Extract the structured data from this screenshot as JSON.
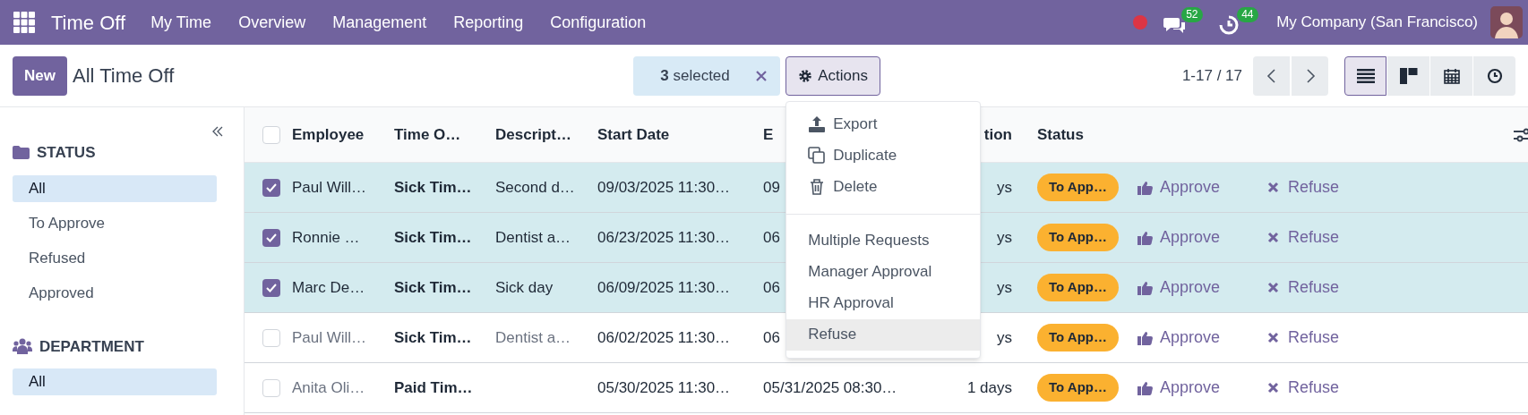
{
  "navbar": {
    "app_title": "Time Off",
    "menu": [
      "My Time",
      "Overview",
      "Management",
      "Reporting",
      "Configuration"
    ],
    "messages_count": "52",
    "activities_count": "44",
    "company": "My Company (San Francisco)"
  },
  "toolbar": {
    "new_button": "New",
    "breadcrumb": "All Time Off",
    "selection": "**3** selected",
    "actions_button": "Actions",
    "pager": "1-17 / 17",
    "views": [
      {
        "kind": "list",
        "selected": true
      },
      {
        "kind": "kanban",
        "selected": false
      },
      {
        "kind": "calendar",
        "selected": false
      },
      {
        "kind": "activity",
        "selected": false
      }
    ]
  },
  "actions_menu": [
    {
      "kind": "export",
      "label": "Export",
      "selected": false
    },
    {
      "kind": "duplicate",
      "label": "Duplicate",
      "selected": false
    },
    {
      "kind": "delete",
      "label": "Delete",
      "selected": false
    },
    {
      "kind": "plain",
      "label": "Multiple Requests",
      "selected": false
    },
    {
      "kind": "plain",
      "label": "Manager Approval",
      "selected": false
    },
    {
      "kind": "plain",
      "label": "HR Approval",
      "selected": false
    },
    {
      "kind": "plain",
      "label": "Refuse",
      "selected": true
    }
  ],
  "sidebar": {
    "sections": [
      {
        "kind": "folder",
        "title": "STATUS",
        "items": [
          {
            "label": "All",
            "selected": true
          },
          {
            "label": "To Approve",
            "selected": false
          },
          {
            "label": "Refused",
            "selected": false
          },
          {
            "label": "Approved",
            "selected": false
          }
        ]
      },
      {
        "kind": "users",
        "title": "DEPARTMENT",
        "items": [
          {
            "label": "All",
            "selected": true
          }
        ]
      }
    ]
  },
  "table": {
    "header_checked": false,
    "columns": [
      "Employee",
      "Time O…",
      "Descript…",
      "Start Date",
      "E",
      "tion",
      "Status"
    ],
    "rows": [
      {
        "selected": true,
        "employee": "Paul Will…",
        "time_off_type": "Sick Tim…",
        "description": "Second d…",
        "start_date": "09/03/2025 11:30…",
        "end_date": "09",
        "duration": "ys",
        "status": "To App…",
        "approve": "Approve",
        "refuse": "Refuse"
      },
      {
        "selected": true,
        "employee": "Ronnie …",
        "time_off_type": "Sick Tim…",
        "description": "Dentist a…",
        "start_date": "06/23/2025 11:30…",
        "end_date": "06",
        "duration": "ys",
        "status": "To App…",
        "approve": "Approve",
        "refuse": "Refuse"
      },
      {
        "selected": true,
        "employee": "Marc De…",
        "time_off_type": "Sick Tim…",
        "description": "Sick day",
        "start_date": "06/09/2025 11:30…",
        "end_date": "06",
        "duration": "ys",
        "status": "To App…",
        "approve": "Approve",
        "refuse": "Refuse"
      },
      {
        "selected": false,
        "employee": "Paul Will…",
        "time_off_type": "Sick Tim…",
        "description": "Dentist a…",
        "start_date": "06/02/2025 11:30…",
        "end_date": "06",
        "duration": "ys",
        "status": "To App…",
        "approve": "Approve",
        "refuse": "Refuse"
      },
      {
        "selected": false,
        "employee": "Anita Oli…",
        "time_off_type": "Paid Tim…",
        "start_date": "05/30/2025 11:30…",
        "end_date": "05/31/2025 08:30…",
        "duration": "1 days",
        "status": "To App…",
        "approve": "Approve",
        "refuse": "Refuse"
      }
    ]
  }
}
